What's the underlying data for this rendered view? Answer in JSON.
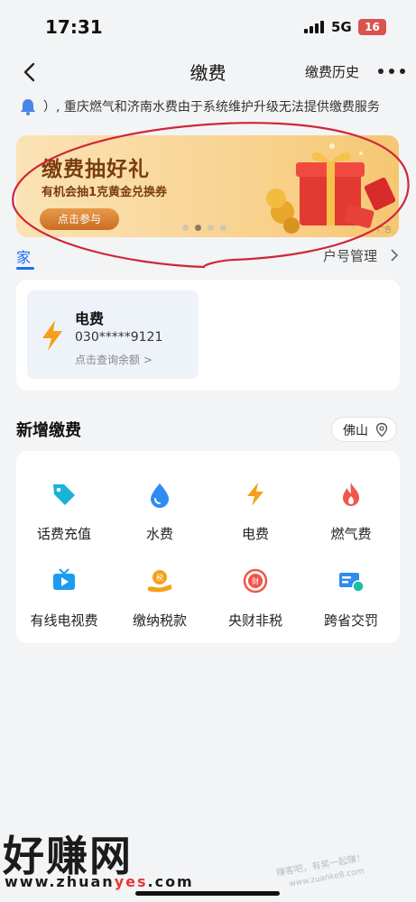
{
  "status_bar": {
    "time": "17:31",
    "network": "5G",
    "battery": "16"
  },
  "nav": {
    "title": "缴费",
    "history_label": "缴费历史"
  },
  "notice": {
    "text": "）, 重庆燃气和济南水费由于系统维护升级无法提供缴费服务"
  },
  "banner": {
    "title": "缴费抽好礼",
    "subtitle": "有机会抽1克黄金兑换券",
    "button_label": "点击参与",
    "ad_tag": "广告",
    "slide_count": 4,
    "active_slide": 2
  },
  "home": {
    "tab_label": "家",
    "manage_label": "户号管理"
  },
  "account": {
    "bill_name": "电费",
    "account_number": "030*****9121",
    "query_label": "点击查询余额 >"
  },
  "add_payment": {
    "title": "新增缴费",
    "city": "佛山",
    "services": [
      {
        "label": "话费充值",
        "icon": "tag-icon",
        "color": "#19b3d9"
      },
      {
        "label": "水费",
        "icon": "water-drop-icon",
        "color": "#2f8bf0"
      },
      {
        "label": "电费",
        "icon": "lightning-icon",
        "color": "#f5a01a"
      },
      {
        "label": "燃气费",
        "icon": "flame-icon",
        "color": "#f2554a"
      },
      {
        "label": "有线电视费",
        "icon": "tv-icon",
        "color": "#1c9bf0"
      },
      {
        "label": "缴纳税款",
        "icon": "tax-hand-icon",
        "color": "#f5a01a"
      },
      {
        "label": "央财非税",
        "icon": "finance-coin-icon",
        "color": "#f2554a"
      },
      {
        "label": "跨省交罚",
        "icon": "fine-card-icon",
        "color": "#2f8bf0"
      }
    ]
  },
  "watermark": {
    "site_name": "好赚网",
    "domain_prefix": "www.zhuan",
    "domain_highlight": "yes",
    "domain_suffix": ".com",
    "stamp_text": "赚客吧，有奖一起赚！www.zuanke8.com"
  },
  "colors": {
    "accent": "#1a6ff0",
    "page_bg": "#f3f4f6",
    "annotation": "#d0263a"
  }
}
